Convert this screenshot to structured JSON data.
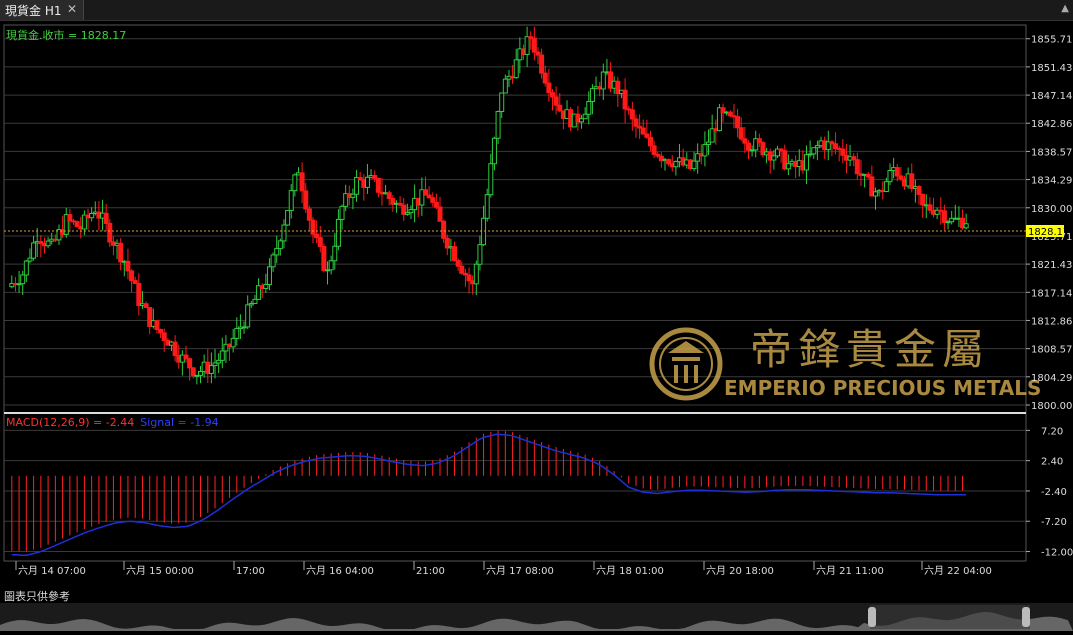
{
  "tab": {
    "title": "現貨金 H1",
    "close": "✕",
    "scroll_arrow": "▲"
  },
  "main_legend": "現貨金.收市 = 1828.17",
  "macd_legend": {
    "macd": "MACD(12,26,9) = -2.44",
    "signal": "Signal = -1.94"
  },
  "price_axis": [
    "1855.71",
    "1851.43",
    "1847.14",
    "1842.86",
    "1838.57",
    "1834.29",
    "1830.00",
    "1825.71",
    "1821.43",
    "1817.14",
    "1812.86",
    "1808.57",
    "1804.29",
    "1800.00"
  ],
  "current_price": "1828.17",
  "macd_axis": [
    "7.20",
    "2.40",
    "-2.40",
    "-7.20",
    "-12.00"
  ],
  "time_axis": [
    "六月 14 07:00",
    "六月 15 00:00",
    "17:00",
    "六月 16 04:00",
    "21:00",
    "六月 17 08:00",
    "六月 18 01:00",
    "六月 20 18:00",
    "六月 21 11:00",
    "六月 22 04:00"
  ],
  "watermark": {
    "chinese": "帝鋒貴金屬",
    "english": "EMPERIO PRECIOUS METALS",
    "logo": "emperio-logo"
  },
  "footer_note": "圖表只供參考",
  "colors": {
    "up": "#2ecc40",
    "down": "#ff1a1a",
    "signal": "#1f2fd6",
    "histogram": "#ff2222",
    "legend_green": "#3fd13f",
    "gold": "#c7a24a"
  },
  "chart_data": {
    "type": "candlestick",
    "title": "現貨金 H1",
    "ylim": [
      1800.0,
      1857.8
    ],
    "close_series": [
      1820,
      1826,
      1824,
      1828,
      1827,
      1830,
      1826,
      1822,
      1816,
      1812,
      1810,
      1807,
      1805,
      1806,
      1808,
      1812,
      1816,
      1820,
      1828,
      1836,
      1826,
      1820,
      1830,
      1834,
      1834,
      1832,
      1830,
      1831,
      1832,
      1826,
      1822,
      1818,
      1832,
      1848,
      1852,
      1856,
      1850,
      1845,
      1843,
      1846,
      1850,
      1848,
      1843,
      1840,
      1838,
      1837,
      1836,
      1839,
      1844,
      1843,
      1840,
      1839,
      1838,
      1836,
      1837,
      1840,
      1839,
      1838,
      1834,
      1832,
      1836,
      1834,
      1830,
      1830,
      1828,
      1828.17
    ],
    "macd": {
      "macd_value": -2.44,
      "signal_value": -1.94,
      "signal_series": [
        -12.5,
        -12.6,
        -12.0,
        -11.0,
        -10.0,
        -9.0,
        -8.2,
        -7.5,
        -7.2,
        -7.4,
        -7.9,
        -8.2,
        -8.0,
        -7.0,
        -5.5,
        -3.8,
        -2.2,
        -0.8,
        0.6,
        1.6,
        2.3,
        2.8,
        3.0,
        3.2,
        3.1,
        2.7,
        2.2,
        1.8,
        1.6,
        2.0,
        3.0,
        4.5,
        6.0,
        6.6,
        6.4,
        5.6,
        4.8,
        4.0,
        3.4,
        2.8,
        1.8,
        0.2,
        -1.8,
        -2.6,
        -2.8,
        -2.5,
        -2.3,
        -2.3,
        -2.4,
        -2.5,
        -2.6,
        -2.5,
        -2.3,
        -2.2,
        -2.2,
        -2.3,
        -2.4,
        -2.5,
        -2.6,
        -2.7,
        -2.7,
        -2.8,
        -2.9,
        -3.0,
        -3.0,
        -3.0
      ],
      "ylim": [
        -13.5,
        9.0
      ]
    }
  }
}
